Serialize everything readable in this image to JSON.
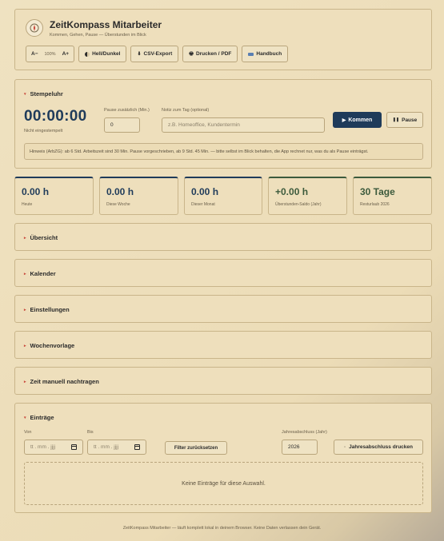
{
  "header": {
    "title": "ZeitKompass Mitarbeiter",
    "subtitle": "Kommen, Gehen, Pause — Überstunden im Blick",
    "zoom": {
      "minus": "A−",
      "value": "100%",
      "plus": "A+"
    },
    "theme_label": "Hell/Dunkel",
    "csv_label": "CSV-Export",
    "print_label": "Drucken / PDF",
    "manual_label": "Handbuch"
  },
  "stamp": {
    "title": "Stempeluhr",
    "clock": "00:00:00",
    "status": "Nicht eingestempelt",
    "pause_label": "Pause zusätzlich (Min.)",
    "pause_value": "0",
    "note_label": "Notiz zum Tag (optional)",
    "note_placeholder": "z.B. Homeoffice, Kundentermin",
    "kommen_label": "Kommen",
    "pause_button": "Pause",
    "hint": "Hinweis (ArbZG): ab 6 Std. Arbeitszeit sind 30 Min. Pause vorgeschrieben, ab 9 Std. 45 Min. — bitte selbst im Blick behalten, die App rechnet nur, was du als Pause einträgst."
  },
  "stats": [
    {
      "value": "0.00 h",
      "caption": "Heute"
    },
    {
      "value": "0.00 h",
      "caption": "Diese Woche"
    },
    {
      "value": "0.00 h",
      "caption": "Dieser Monat"
    },
    {
      "value": "+0.00 h",
      "caption": "Überstunden-Saldo (Jahr)"
    },
    {
      "value": "30 Tage",
      "caption": "Resturlaub 2026"
    }
  ],
  "sections": [
    "Übersicht",
    "Kalender",
    "Einstellungen",
    "Wochenvorlage",
    "Zeit manuell nachtragen"
  ],
  "entries": {
    "title": "Einträge",
    "from_label": "Von",
    "to_label": "Bis",
    "date_placeholder": "tt . mm . jjjj",
    "filter_reset": "Filter zurücksetzen",
    "year_label": "Jahresabschluss (Jahr)",
    "year_value": "2026",
    "year_print": "Jahresabschluss drucken",
    "empty": "Keine Einträge für diese Auswahl."
  },
  "footer": "ZeitKompass Mitarbeiter — läuft komplett lokal in deinem Browser. Keine Daten verlassen dein Gerät.",
  "colors": {
    "accent": "#1f3b5a",
    "positive": "#3c5a3c",
    "chevron": "#c9483c",
    "background": "#eedfbc"
  }
}
